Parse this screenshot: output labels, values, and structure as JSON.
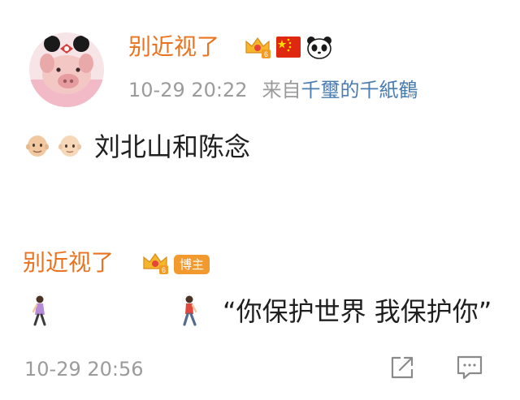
{
  "post": {
    "author": "别近视了",
    "timestamp": "10-29 20:22",
    "source_prefix": "来自",
    "source_name": "千璽的千紙鶴",
    "badges": [
      "crown-vip-icon",
      "china-flag-icon",
      "panda-icon"
    ],
    "body_emoji": [
      "bald-man-emoji",
      "bald-person-emoji"
    ],
    "body_text": "刘北山和陈念"
  },
  "reply": {
    "author": "别近视了",
    "badges": [
      "crown-vip-icon"
    ],
    "owner_badge": "博主",
    "body_emoji": [
      "woman-walking-emoji",
      "man-walking-emoji"
    ],
    "text": "“你保护世界 我保护你”",
    "timestamp": "10-29 20:56",
    "actions": [
      "share-icon",
      "comment-icon"
    ]
  },
  "colors": {
    "author": "#e9731e",
    "meta": "#9b9b9b",
    "link": "#4b7db0",
    "owner_badge_bg": "#f29a2e",
    "text": "#1f1f1f"
  }
}
